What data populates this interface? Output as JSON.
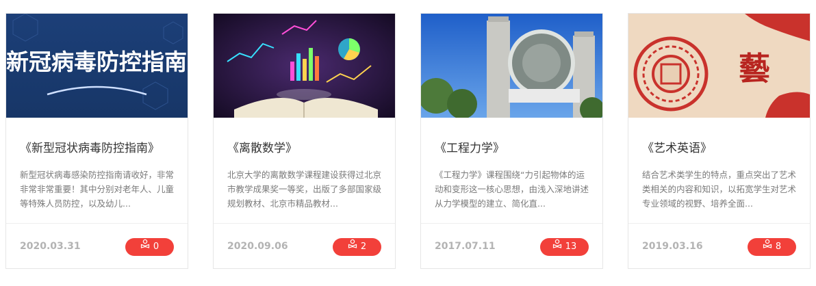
{
  "courses": [
    {
      "title": "《新型冠状病毒防控指南》",
      "description": "新型冠状病毒感染防控指南请收好，非常非常非常重要！其中分别对老年人、儿童等特殊人员防控，以及幼儿...",
      "date": "2020.03.31",
      "count": "0",
      "banner_text": "新冠病毒防控指南",
      "badge_icon": "learners-icon"
    },
    {
      "title": "《离散数学》",
      "description": "北京大学的离散数学课程建设获得过北京市教学成果奖一等奖，出版了多部国家级规划教材、北京市精品教材...",
      "date": "2020.09.06",
      "count": "2",
      "badge_icon": "learners-icon"
    },
    {
      "title": "《工程力学》",
      "description": "《工程力学》课程围绕“力引起物体的运动和变形这一核心思想，由浅入深地讲述从力学模型的建立、简化直...",
      "date": "2017.07.11",
      "count": "13",
      "badge_icon": "learners-icon"
    },
    {
      "title": "《艺术英语》",
      "description": "结合艺术类学生的特点，重点突出了艺术类相关的内容和知识，以拓宽学生对艺术专业领域的视野、培养全面...",
      "date": "2019.03.16",
      "count": "8",
      "banner_text": "藝",
      "badge_icon": "learners-icon"
    }
  ],
  "colors": {
    "badge": "#f2403a",
    "date": "#b3b3b3",
    "title": "#333333",
    "description": "#7a7a7a"
  }
}
